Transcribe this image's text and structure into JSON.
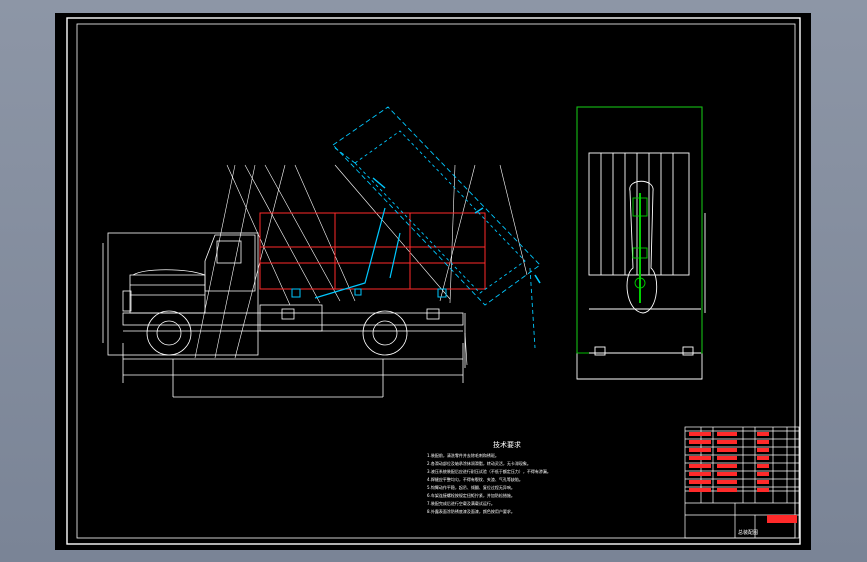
{
  "window": {
    "title": "",
    "background_color": "#000000",
    "frame_color": "#8d96a6"
  },
  "colors": {
    "outline": "#ffffff",
    "hook_arm": "#00c8ff",
    "container_box": "#ff2a2a",
    "top_view_frame": "#00d000",
    "dimension": "#ffffff"
  },
  "notes": {
    "title": "技术要求",
    "lines": [
      "1.装配前，清洗零件并去除毛刺和锈斑。",
      "2.各滑动部位及轴承涂抹润滑脂，转动灵活，无卡滞现象。",
      "3.液压系统装配后应进行耐压试验（不低于额定压力），不得有渗漏。",
      "4.焊缝应平整均匀，不得有裂纹、夹渣、气孔等缺陷。",
      "5.钩臂动作平稳，起吊、倾翻、复位过程无异响。",
      "6.车架连接螺栓按规定扭矩拧紧，并加防松措施。",
      "7.装配完成后进行空载及满载试运行。",
      "8.外露表面涂防锈底漆及面漆，颜色按用户要求。"
    ]
  },
  "title_block": {
    "drawing_name": "总装配图",
    "school_mark": "",
    "scale_label": "比例",
    "sheet_label": "共 张 第 张"
  }
}
